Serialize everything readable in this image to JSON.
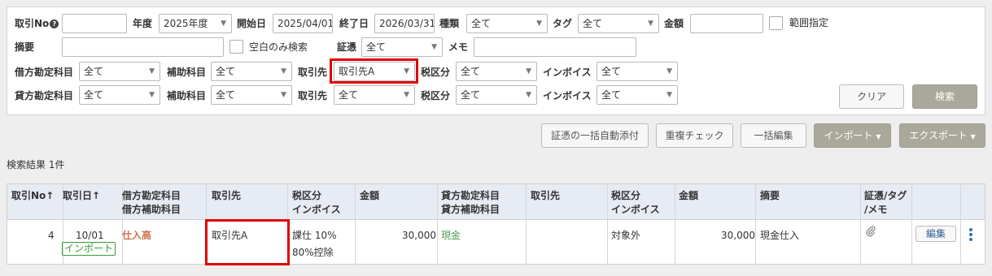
{
  "search": {
    "torihiki_no_label": "取引No",
    "torihiki_no_help": "?",
    "torihiki_no_value": "",
    "nendo_label": "年度",
    "nendo_value": "2025年度",
    "start_label": "開始日",
    "start_value": "2025/04/01",
    "end_label": "終了日",
    "end_value": "2026/03/31",
    "kind_label": "種類",
    "kind_value": "全て",
    "tag_label": "タグ",
    "tag_value": "全て",
    "amount_label": "金額",
    "amount_value": "",
    "range_label": "範囲指定",
    "memo_summary_label": "摘要",
    "memo_summary_value": "",
    "blank_only_label": "空白のみ検索",
    "evidence_label": "証憑",
    "evidence_value": "全て",
    "memo_label": "メモ",
    "memo_value": "",
    "debit_account_label": "借方勘定科目",
    "debit_account_value": "全て",
    "debit_sub_label": "補助科目",
    "debit_sub_value": "全て",
    "debit_partner_label": "取引先",
    "debit_partner_value": "取引先A",
    "debit_tax_label": "税区分",
    "debit_tax_value": "全て",
    "debit_invoice_label": "インボイス",
    "debit_invoice_value": "全て",
    "credit_account_label": "貸方勘定科目",
    "credit_account_value": "全て",
    "credit_sub_label": "補助科目",
    "credit_sub_value": "全て",
    "credit_partner_label": "取引先",
    "credit_partner_value": "全て",
    "credit_tax_label": "税区分",
    "credit_tax_value": "全て",
    "credit_invoice_label": "インボイス",
    "credit_invoice_value": "全て",
    "clear_button": "クリア",
    "search_button": "検索"
  },
  "toolbar": {
    "auto_attach": "証憑の一括自動添付",
    "dup_check": "重複チェック",
    "bulk_edit": "一括編集",
    "import": "インポート",
    "export": "エクスポート"
  },
  "result_count": "検索結果 1件",
  "table": {
    "headers": {
      "no": "取引No",
      "date": "取引日",
      "debit_account_1": "借方勘定科目",
      "debit_account_2": "借方補助科目",
      "debit_partner": "取引先",
      "debit_tax_1": "税区分",
      "debit_tax_2": "インボイス",
      "debit_amount": "金額",
      "credit_account_1": "貸方勘定科目",
      "credit_account_2": "貸方補助科目",
      "credit_partner": "取引先",
      "credit_tax_1": "税区分",
      "credit_tax_2": "インボイス",
      "credit_amount": "金額",
      "summary": "摘要",
      "evidence_1": "証憑/タグ",
      "evidence_2": "/メモ"
    },
    "rows": [
      {
        "no": "4",
        "date": "10/01",
        "badge": "インポート",
        "debit_account": "仕入高",
        "debit_partner": "取引先A",
        "debit_tax": "課仕 10%",
        "debit_invoice": "80%控除",
        "debit_amount": "30,000",
        "credit_account": "現金",
        "credit_partner": "",
        "credit_tax": "対象外",
        "credit_amount": "30,000",
        "summary": "現金仕入",
        "edit_button": "編集"
      }
    ]
  },
  "colors": {
    "debit_account": "#d0714a",
    "credit_account": "#4f9a4f",
    "badge": "#3a9a3a",
    "highlight": "#e00000",
    "header_bg": "#e6ebf4",
    "gray_button": "#aaa89a",
    "kebab": "#2f6fb0"
  }
}
